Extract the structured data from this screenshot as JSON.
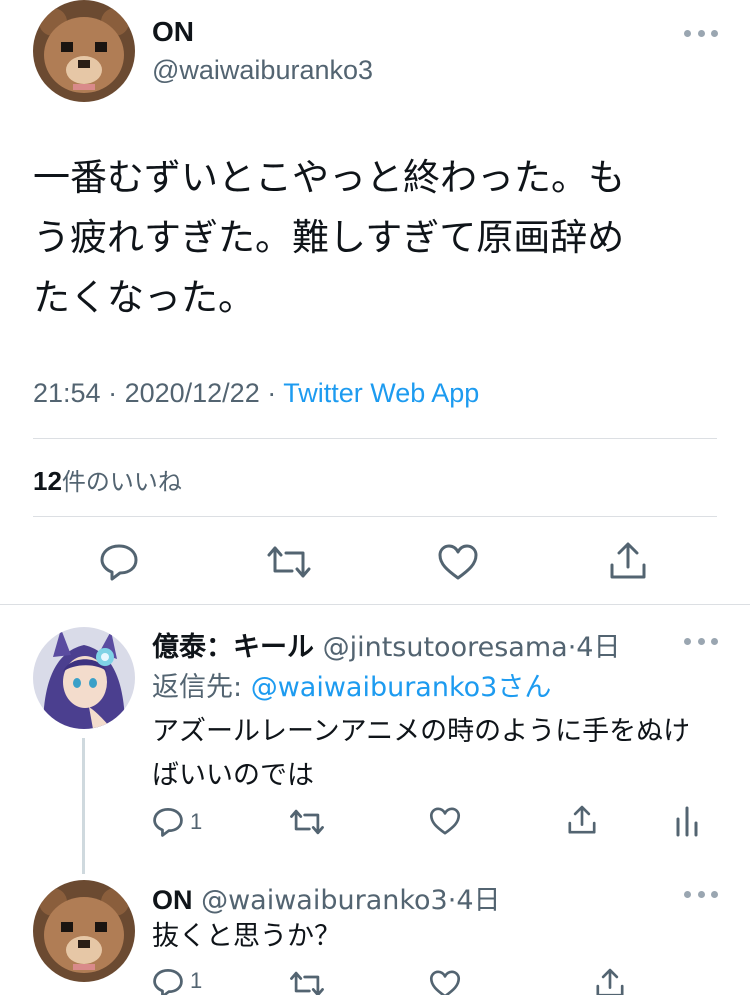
{
  "main_tweet": {
    "display_name": "ON",
    "handle": "@waiwaiburanko3",
    "text_lines": [
      "一番むずいとこやっと終わった。も",
      "う疲れすぎた。難しすぎて原画辞め",
      "たくなった。"
    ],
    "time": "21:54",
    "date": "2020/12/22",
    "separator": " · ",
    "client": "Twitter Web App",
    "likes_count": "12",
    "likes_label": "件のいいね"
  },
  "reply": {
    "display_name": "億泰：キール",
    "handle": "@jintsutooresama",
    "age": "4日",
    "reply_to_label": "返信先: ",
    "reply_to_user": "@waiwaiburanko3",
    "reply_to_suffix": "さん",
    "text_lines": [
      "アズールレーンアニメの時のように手をぬけ",
      "ばいいのでは"
    ],
    "reply_count": "1"
  },
  "reply2": {
    "display_name": "ON",
    "handle": "@waiwaiburanko3",
    "age": "4日",
    "text": "抜くと思うか？",
    "reply_count": "1"
  },
  "icons": {
    "more": "more-horizontal-icon",
    "reply": "reply-icon",
    "retweet": "retweet-icon",
    "like": "heart-icon",
    "share": "share-icon",
    "analytics": "analytics-icon"
  },
  "colors": {
    "link": "#1d9bf0",
    "secondary_text": "#536471",
    "primary_text": "#0f1419",
    "divider": "#dcdfe3"
  }
}
